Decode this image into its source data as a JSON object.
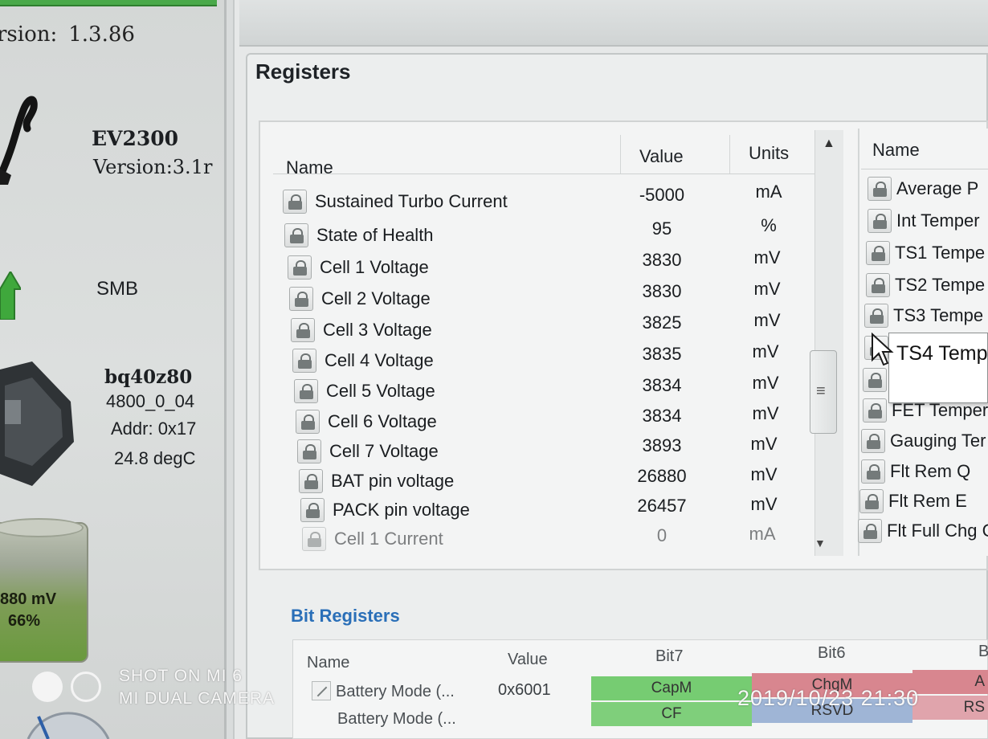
{
  "left_panel": {
    "fw_version_label": "rsion:",
    "fw_version_value": "1.3.86",
    "adapter_name": "EV2300",
    "adapter_version": "Version:3.1r",
    "bus": "SMB",
    "device_name": "bq40z80",
    "device_fw": "4800_0_04",
    "device_addr": "Addr: 0x17",
    "device_temp": "24.8 degC",
    "battery_voltage": "880 mV",
    "battery_percent": "66%",
    "battery_level": 0.66,
    "colors": {
      "status_green": "#4aa94a",
      "battery_green": "#6a9a3e"
    }
  },
  "registers": {
    "title": "Registers",
    "columns": {
      "name": "Name",
      "value": "Value",
      "units": "Units"
    },
    "rows": [
      {
        "name": "Sustained Turbo Current",
        "value": "-5000",
        "unit": "mA"
      },
      {
        "name": "State of Health",
        "value": "95",
        "unit": "%"
      },
      {
        "name": "Cell 1 Voltage",
        "value": "3830",
        "unit": "mV"
      },
      {
        "name": "Cell 2 Voltage",
        "value": "3830",
        "unit": "mV"
      },
      {
        "name": "Cell 3 Voltage",
        "value": "3825",
        "unit": "mV"
      },
      {
        "name": "Cell 4 Voltage",
        "value": "3835",
        "unit": "mV"
      },
      {
        "name": "Cell 5 Voltage",
        "value": "3834",
        "unit": "mV"
      },
      {
        "name": "Cell 6 Voltage",
        "value": "3834",
        "unit": "mV"
      },
      {
        "name": "Cell 7 Voltage",
        "value": "3893",
        "unit": "mV"
      },
      {
        "name": "BAT pin voltage",
        "value": "26880",
        "unit": "mV"
      },
      {
        "name": "PACK pin voltage",
        "value": "26457",
        "unit": "mV"
      },
      {
        "name": "Cell 1 Current",
        "value": "0",
        "unit": "mA"
      }
    ],
    "right_column": {
      "header": "Name",
      "rows": [
        "Average P",
        "Int Temper",
        "TS1 Tempe",
        "TS2 Tempe",
        "TS3 Tempe",
        "",
        "FET Temper",
        "Gauging Ter",
        "Flt Rem Q",
        "Flt Rem E",
        "Flt Full Chg C"
      ]
    },
    "tooltip": "TS4 Temp",
    "icons": {
      "lock": "lock-icon",
      "scroll_up": "▲",
      "scroll_down": "▼",
      "grip": "≡"
    }
  },
  "bit_registers": {
    "title": "Bit Registers",
    "columns": {
      "name": "Name",
      "value": "Value",
      "bit7": "Bit7",
      "bit6": "Bit6",
      "bit5": "B"
    },
    "rows": [
      {
        "name": "Battery Mode (...",
        "value": "0x6001",
        "bit7": "CapM",
        "bit6": "ChgM",
        "bit5": "A"
      },
      {
        "name": "Battery Mode (...",
        "value": "",
        "bit7": "CF",
        "bit6": "RSVD",
        "bit5": "RS"
      }
    ]
  },
  "watermark": {
    "line1": "SHOT ON MI 6",
    "line2": "MI DUAL CAMERA",
    "datetime": "2019/10/23  21:30"
  }
}
